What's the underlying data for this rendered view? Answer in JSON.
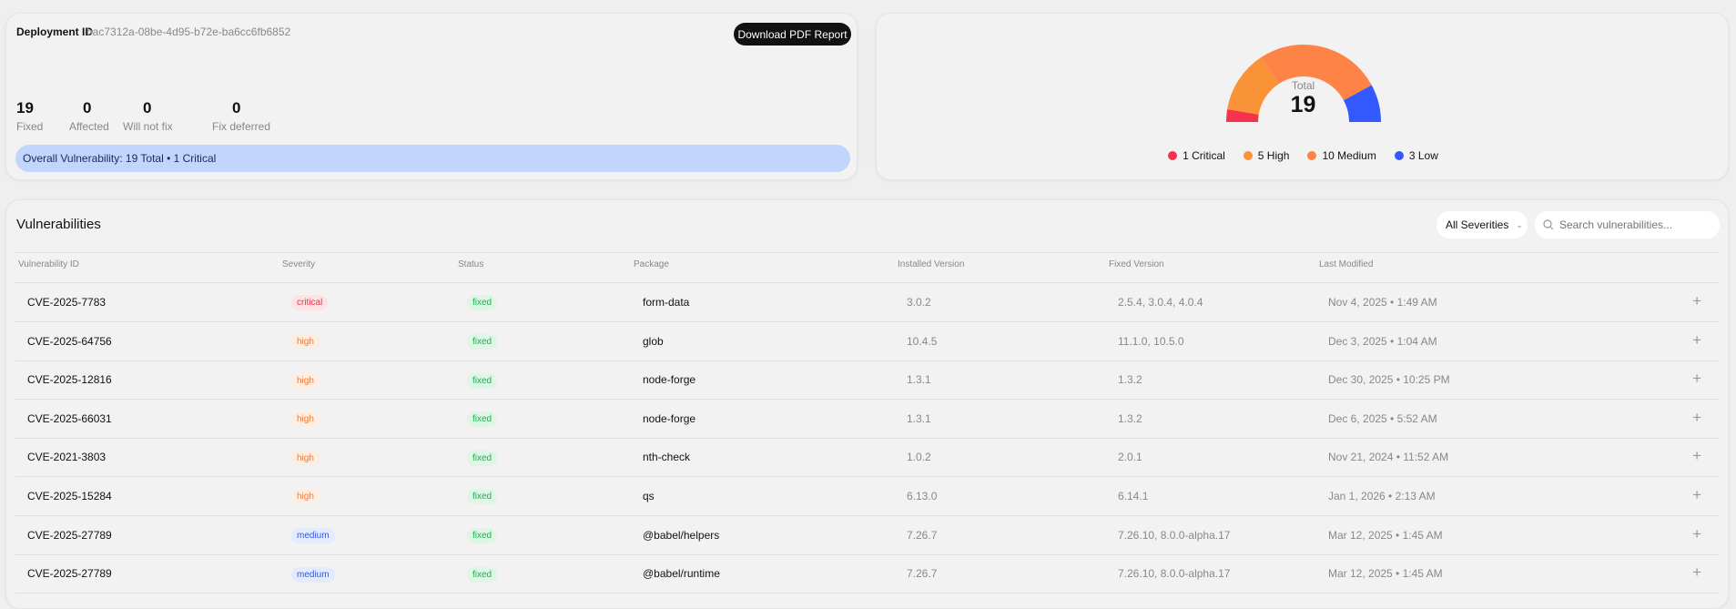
{
  "summary": {
    "deployment_label": "Deployment ID",
    "deployment_id": "bac7312a-08be-4d95-b72e-ba6cc6fb6852",
    "download_button": "Download PDF Report",
    "stats": [
      {
        "value": "19",
        "label": "Fixed"
      },
      {
        "value": "0",
        "label": "Affected"
      },
      {
        "value": "0",
        "label": "Will not fix"
      },
      {
        "value": "0",
        "label": "Fix deferred"
      }
    ],
    "banner": "Overall Vulnerability: 19 Total • 1 Critical"
  },
  "chart_data": {
    "type": "pie",
    "variant": "semi-donut",
    "center_label": "Total",
    "center_value": "19",
    "slices": [
      {
        "name": "Critical",
        "value": 1,
        "label": "1 Critical",
        "color": "#f5334b"
      },
      {
        "name": "High",
        "value": 5,
        "label": "5 High",
        "color": "#fa9237"
      },
      {
        "name": "Medium",
        "value": 10,
        "label": "10 Medium",
        "color": "#fd8346"
      },
      {
        "name": "Low",
        "value": 3,
        "label": "3 Low",
        "color": "#3358fd"
      }
    ]
  },
  "table": {
    "title": "Vulnerabilities",
    "filter": "All Severities",
    "search_placeholder": "Search vulnerabilities...",
    "columns": [
      "Vulnerability ID",
      "Severity",
      "Status",
      "Package",
      "Installed Version",
      "Fixed Version",
      "Last Modified"
    ],
    "rows": [
      {
        "id": "CVE-2025-7783",
        "severity": "critical",
        "status": "fixed",
        "package": "form-data",
        "installed": "3.0.2",
        "fixed": "2.5.4, 3.0.4, 4.0.4",
        "modified": "Nov 4, 2025 • 1:49 AM"
      },
      {
        "id": "CVE-2025-64756",
        "severity": "high",
        "status": "fixed",
        "package": "glob",
        "installed": "10.4.5",
        "fixed": "11.1.0, 10.5.0",
        "modified": "Dec 3, 2025 • 1:04 AM"
      },
      {
        "id": "CVE-2025-12816",
        "severity": "high",
        "status": "fixed",
        "package": "node-forge",
        "installed": "1.3.1",
        "fixed": "1.3.2",
        "modified": "Dec 30, 2025 • 10:25 PM"
      },
      {
        "id": "CVE-2025-66031",
        "severity": "high",
        "status": "fixed",
        "package": "node-forge",
        "installed": "1.3.1",
        "fixed": "1.3.2",
        "modified": "Dec 6, 2025 • 5:52 AM"
      },
      {
        "id": "CVE-2021-3803",
        "severity": "high",
        "status": "fixed",
        "package": "nth-check",
        "installed": "1.0.2",
        "fixed": "2.0.1",
        "modified": "Nov 21, 2024 • 11:52 AM"
      },
      {
        "id": "CVE-2025-15284",
        "severity": "high",
        "status": "fixed",
        "package": "qs",
        "installed": "6.13.0",
        "fixed": "6.14.1",
        "modified": "Jan 1, 2026 • 2:13 AM"
      },
      {
        "id": "CVE-2025-27789",
        "severity": "medium",
        "status": "fixed",
        "package": "@babel/helpers",
        "installed": "7.26.7",
        "fixed": "7.26.10, 8.0.0-alpha.17",
        "modified": "Mar 12, 2025 • 1:45 AM"
      },
      {
        "id": "CVE-2025-27789",
        "severity": "medium",
        "status": "fixed",
        "package": "@babel/runtime",
        "installed": "7.26.7",
        "fixed": "7.26.10, 8.0.0-alpha.17",
        "modified": "Mar 12, 2025 • 1:45 AM"
      }
    ]
  }
}
